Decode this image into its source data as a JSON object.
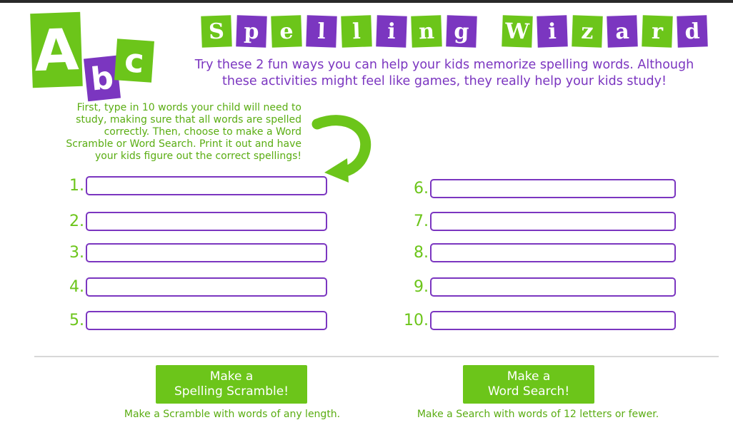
{
  "logo": {
    "letters": [
      "A",
      "b",
      "c"
    ]
  },
  "title": {
    "word1": [
      "S",
      "p",
      "e",
      "l",
      "l",
      "i",
      "n",
      "g"
    ],
    "word2": [
      "W",
      "i",
      "z",
      "a",
      "r",
      "d"
    ]
  },
  "subtitle": {
    "line1": "Try these 2 fun ways you can help your kids memorize spelling words. Although",
    "line2": "these activities might feel like games, they really help your kids study!"
  },
  "instructions": {
    "line1": "First, type in 10 words your child will need to",
    "line2": "study, making sure that all words are spelled",
    "line3": "correctly. Then, choose to make a Word",
    "line4": "Scramble or Word Search. Print it out and have",
    "line5": "your kids figure out the correct spellings!"
  },
  "words": [
    {
      "label": "1.",
      "value": ""
    },
    {
      "label": "2.",
      "value": ""
    },
    {
      "label": "3.",
      "value": ""
    },
    {
      "label": "4.",
      "value": ""
    },
    {
      "label": "5.",
      "value": ""
    },
    {
      "label": "6.",
      "value": ""
    },
    {
      "label": "7.",
      "value": ""
    },
    {
      "label": "8.",
      "value": ""
    },
    {
      "label": "9.",
      "value": ""
    },
    {
      "label": "10.",
      "value": ""
    }
  ],
  "buttons": {
    "scramble": {
      "line1": "Make a",
      "line2": "Spelling Scramble!",
      "note": "Make a Scramble with words of any length."
    },
    "search": {
      "line1": "Make a",
      "line2": "Word Search!",
      "note": "Make a Search with words of 12 letters or fewer."
    }
  },
  "colors": {
    "green": "#6cc51a",
    "purple": "#7b36c0"
  },
  "icons": {
    "arrow": "curved-arrow-icon"
  }
}
